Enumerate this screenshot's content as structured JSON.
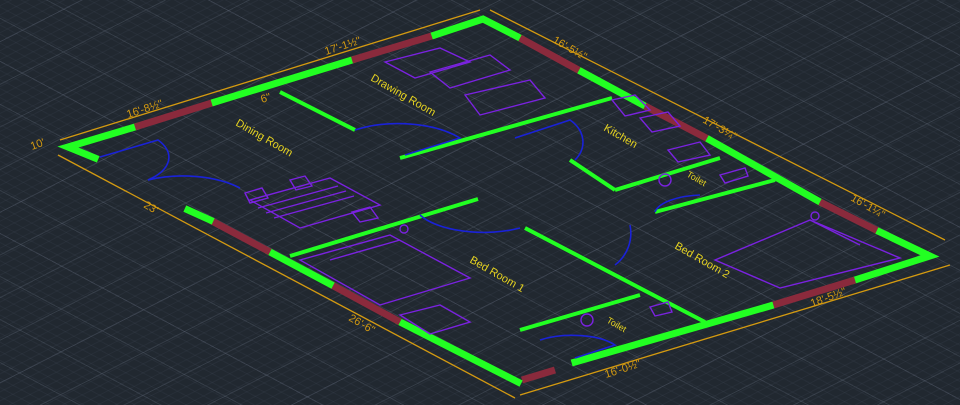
{
  "colors": {
    "background": "#212830",
    "wall": "#22ff22",
    "window": "#8a2a3c",
    "door": "#1a22d8",
    "furniture": "#7a22e0",
    "dimension": "#d49a10",
    "room_label": "#e6d320"
  },
  "rooms": {
    "drawing": "Drawing Room",
    "dining": "Dining Room",
    "kitchen": "Kitchen",
    "toilet_1": "Toilet",
    "bed_1": "Bed Room 1",
    "bed_2": "Bed Room 2",
    "toilet_2": "Toilet"
  },
  "dimensions": {
    "left_short": "10'",
    "top_left": "16'-8½\"",
    "top_middle": "17'-1½\"",
    "partition": "6\"",
    "right_top": "16'-5½\"",
    "right_middle": "17'-3¼\"",
    "right_bottom": "16'-1¼\"",
    "bottom_right": "18'-5½\"",
    "bottom_middle": "16'-0½\"",
    "left_lower": "26'-6\"",
    "left_upper": "23'"
  }
}
